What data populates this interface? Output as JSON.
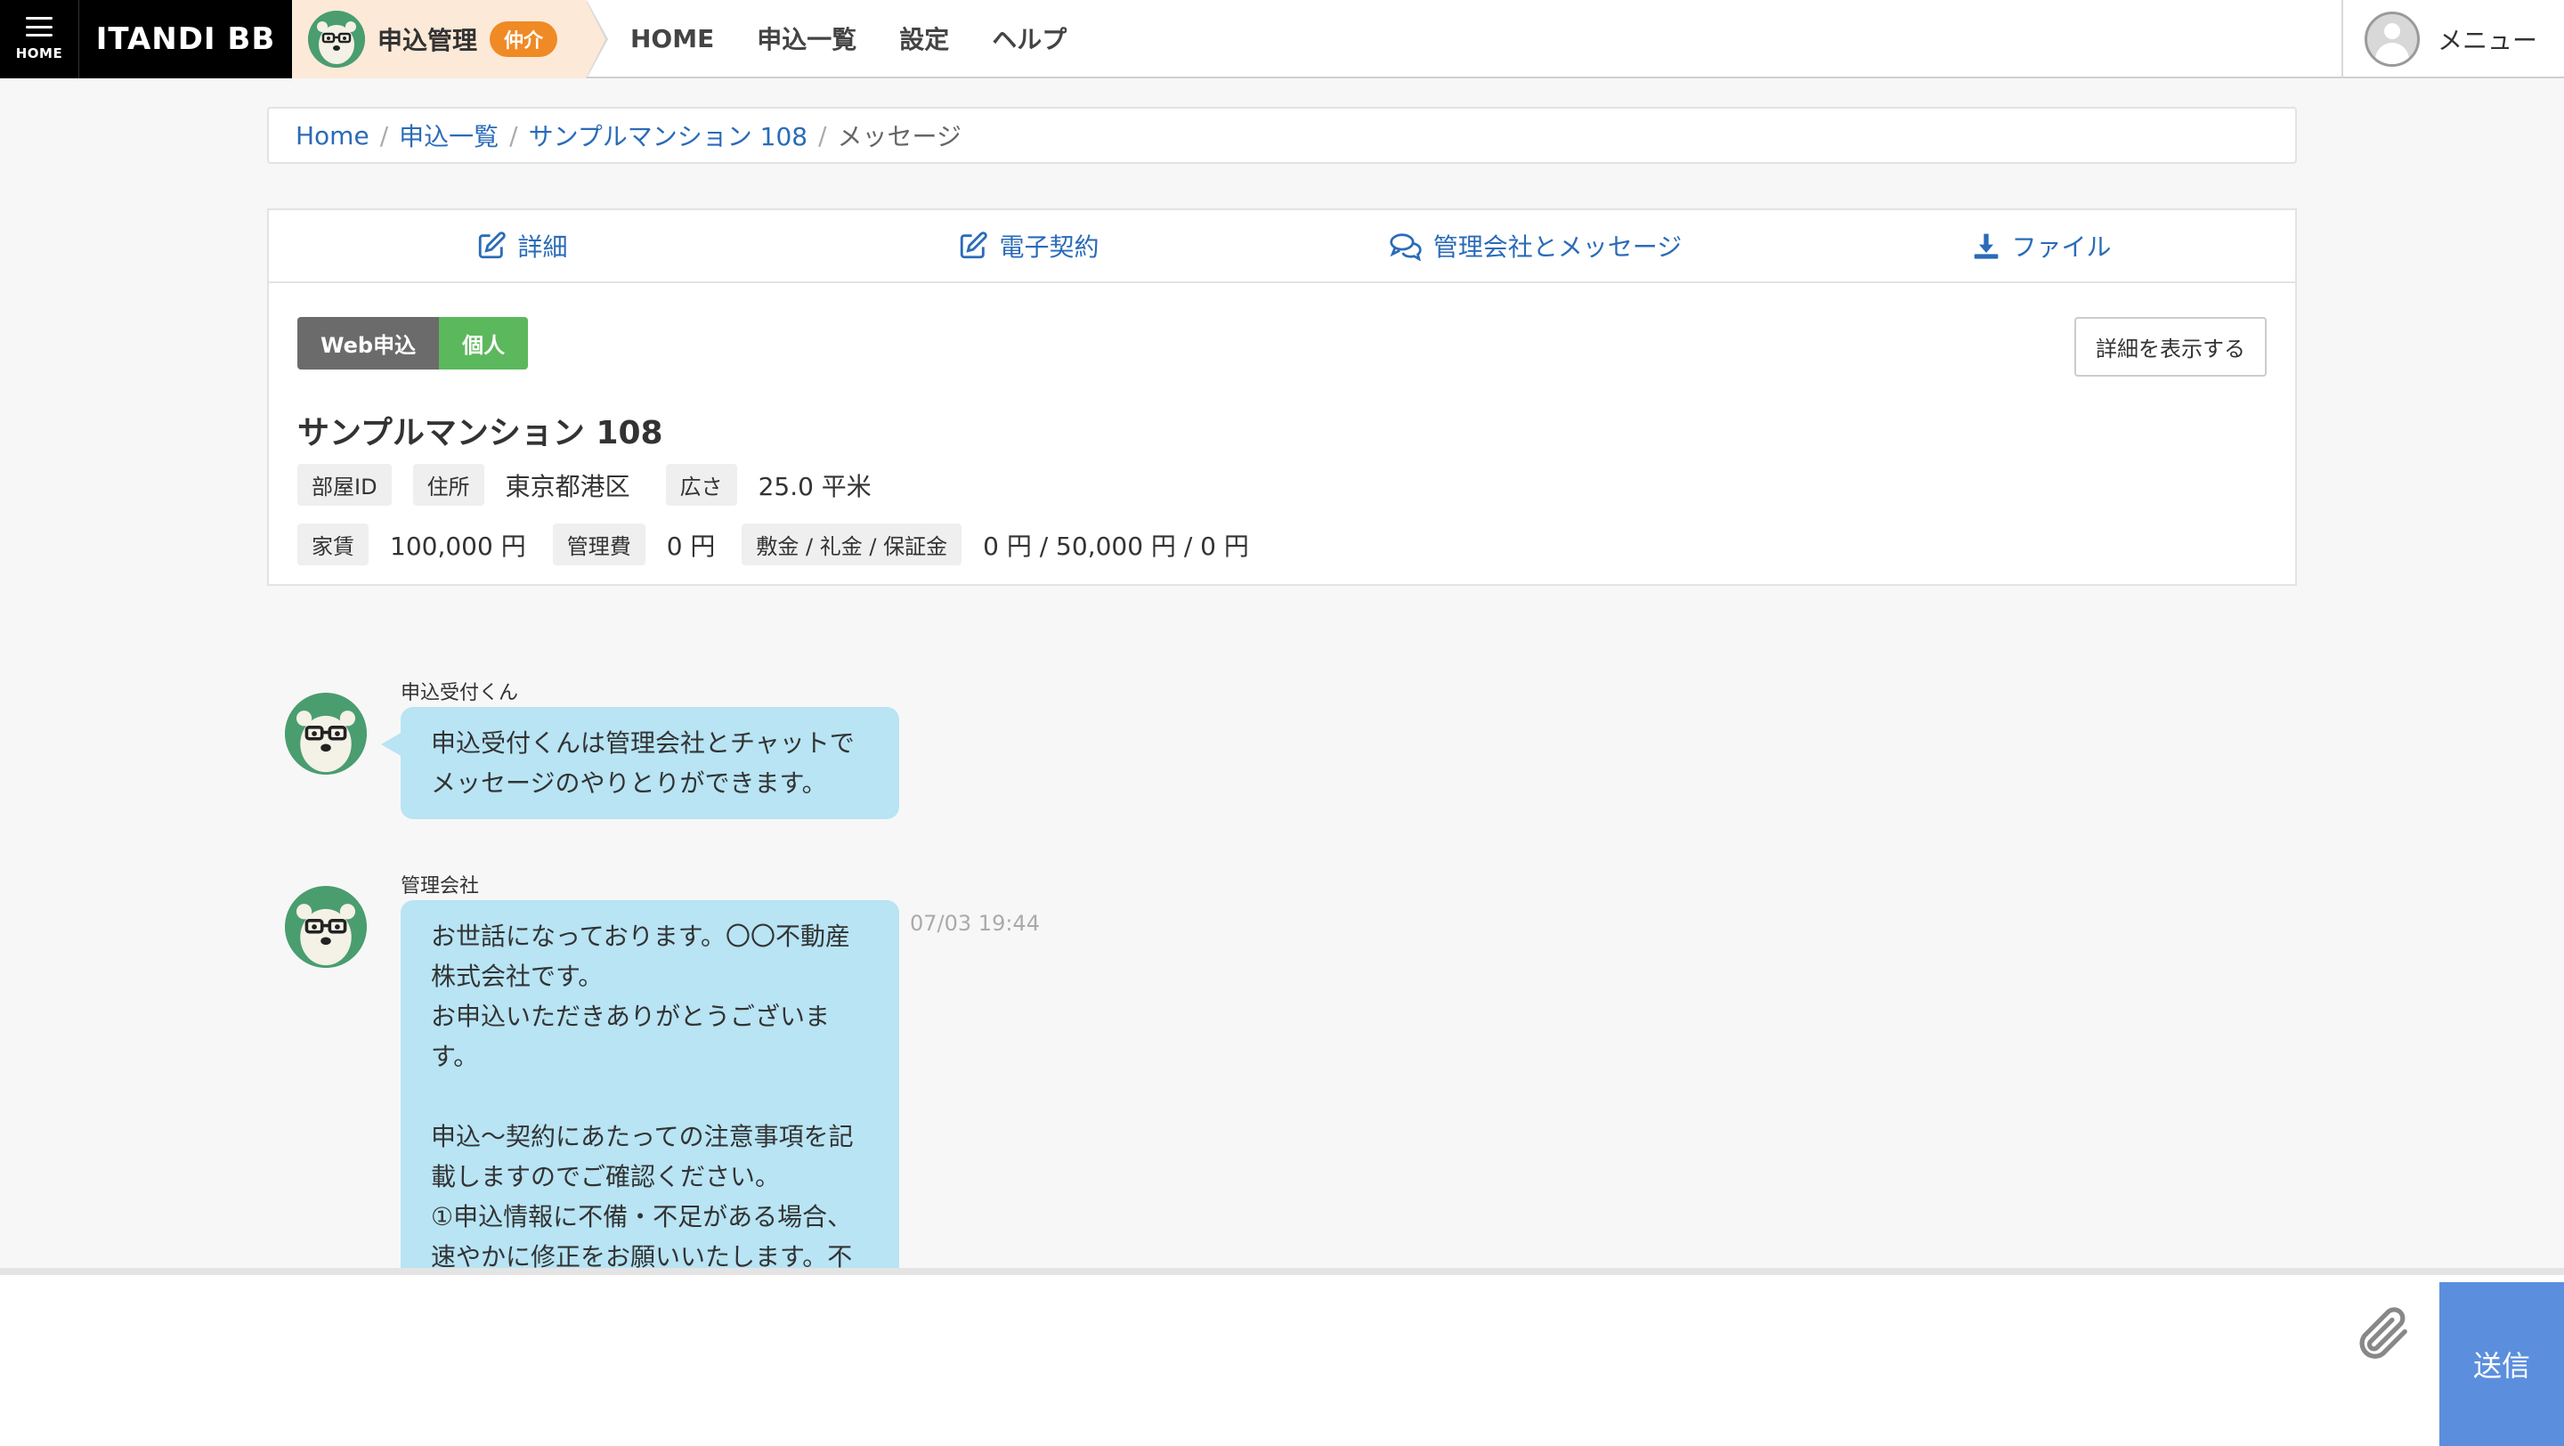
{
  "nav": {
    "home_label": "HOME",
    "brand": "ITANDI BB",
    "app_title": "申込管理",
    "app_badge": "仲介",
    "links": [
      "HOME",
      "申込一覧",
      "設定",
      "ヘルプ"
    ],
    "menu_label": "メニュー"
  },
  "breadcrumb": {
    "items": [
      "Home",
      "申込一覧",
      "サンプルマンション 108"
    ],
    "current": "メッセージ"
  },
  "tabs": [
    {
      "label": "詳細",
      "icon": "edit-icon"
    },
    {
      "label": "電子契約",
      "icon": "edit-icon"
    },
    {
      "label": "管理会社とメッセージ",
      "icon": "chat-icon"
    },
    {
      "label": "ファイル",
      "icon": "download-icon"
    }
  ],
  "application": {
    "type_tag": "Web申込",
    "person_tag": "個人",
    "detail_button": "詳細を表示する",
    "property_name": "サンプルマンション 108",
    "room_id_label": "部屋ID",
    "room_id_value": "",
    "address_label": "住所",
    "address_value": "東京都港区",
    "area_label": "広さ",
    "area_value": "25.0 平米",
    "rent_label": "家賃",
    "rent_value": "100,000 円",
    "mgmt_fee_label": "管理費",
    "mgmt_fee_value": "0 円",
    "deposit_label": "敷金 / 礼金 / 保証金",
    "deposit_value": "0 円 / 50,000 円 / 0 円"
  },
  "messages": [
    {
      "sender": "申込受付くん",
      "text": "申込受付くんは管理会社とチャットで\nメッセージのやりとりができます。",
      "time": ""
    },
    {
      "sender": "管理会社",
      "text": "お世話になっております。〇〇不動産\n株式会社です。\nお申込いただきありがとうございま\nす。\n\n申込〜契約にあたっての注意事項を記\n載しますのでご確認ください。\n①申込情報に不備・不足がある場合、\n速やかに修正をお願いいたします。不",
      "time": "07/03 19:44"
    }
  ],
  "composer": {
    "placeholder": "",
    "send_label": "送信"
  },
  "colors": {
    "accent_blue": "#2a6bb8",
    "bubble": "#b8e4f4",
    "send_button": "#5b8fde",
    "badge_orange": "#f08a24",
    "tag_green": "#5cb85c"
  }
}
